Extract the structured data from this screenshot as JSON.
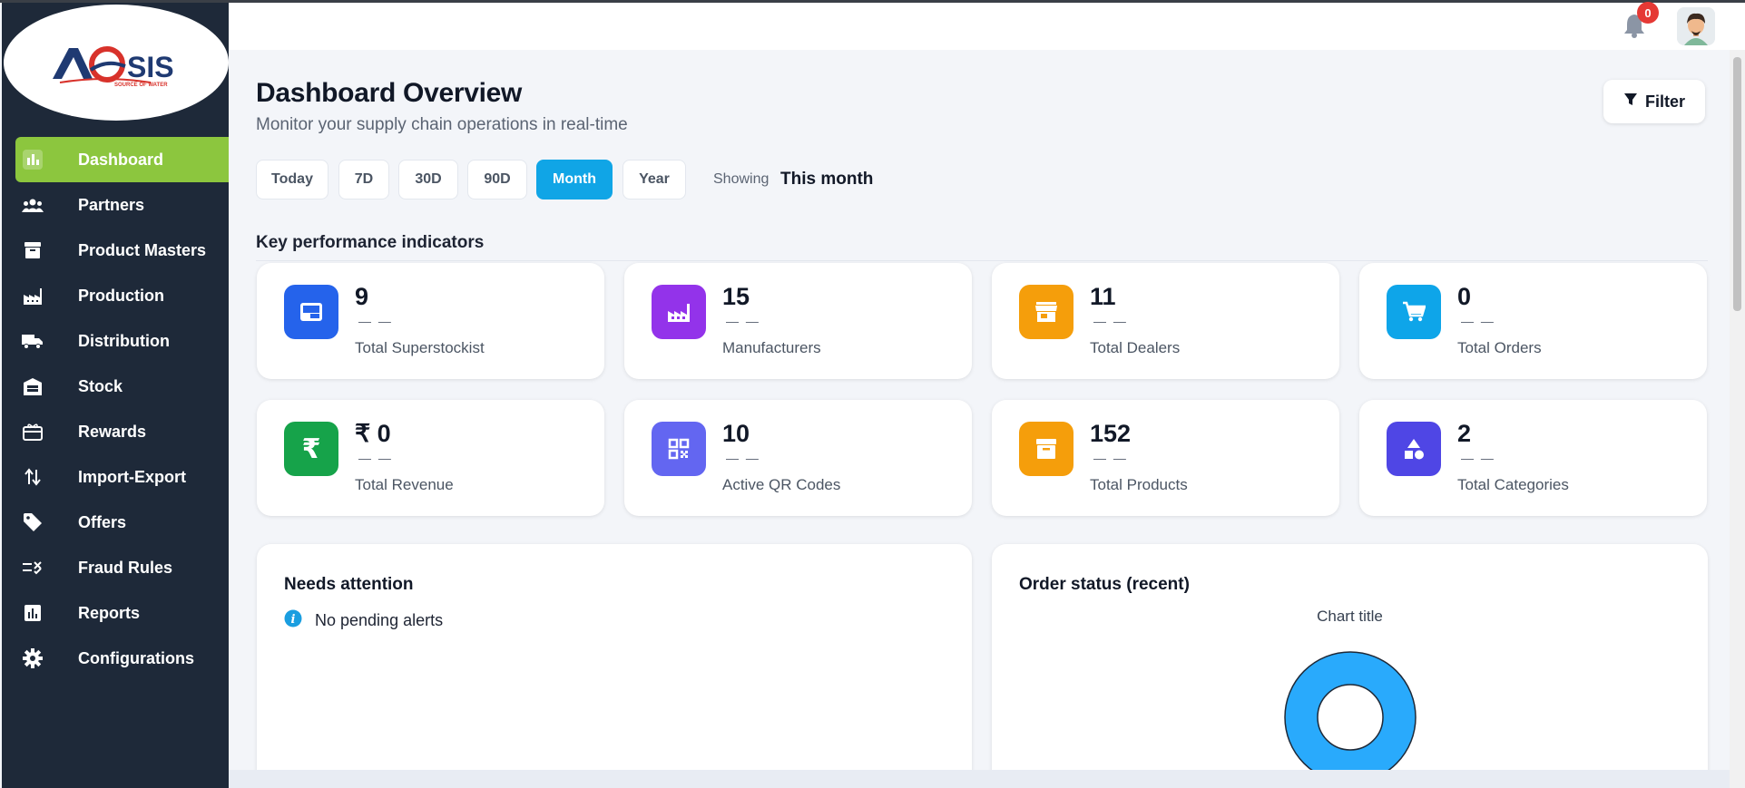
{
  "brand": {
    "logo_text": "AQSIS",
    "tagline": "SOURCE OF WATER"
  },
  "sidebar": {
    "items": [
      {
        "label": "Dashboard",
        "icon": "bar-chart-icon",
        "active": true
      },
      {
        "label": "Partners",
        "icon": "group-icon"
      },
      {
        "label": "Product Masters",
        "icon": "archive-box-icon"
      },
      {
        "label": "Production",
        "icon": "factory-icon"
      },
      {
        "label": "Distribution",
        "icon": "truck-icon"
      },
      {
        "label": "Stock",
        "icon": "warehouse-icon"
      },
      {
        "label": "Rewards",
        "icon": "gift-card-icon"
      },
      {
        "label": "Import-Export",
        "icon": "swap-arrows-icon"
      },
      {
        "label": "Offers",
        "icon": "tag-icon"
      },
      {
        "label": "Fraud Rules",
        "icon": "rule-icon"
      },
      {
        "label": "Reports",
        "icon": "report-icon"
      },
      {
        "label": "Configurations",
        "icon": "gear-icon"
      }
    ]
  },
  "header": {
    "notification_count": "0"
  },
  "main": {
    "title": "Dashboard Overview",
    "subtitle": "Monitor your supply chain operations in real-time",
    "filter_label": "Filter",
    "ranges": [
      "Today",
      "7D",
      "30D",
      "90D",
      "Month",
      "Year"
    ],
    "active_range": "Month",
    "showing_label": "Showing",
    "showing_value": "This month",
    "kpi_section_title": "Key performance indicators",
    "kpis": [
      {
        "value": "9",
        "trend": "— —",
        "label": "Total Superstockist",
        "color": "#2563eb",
        "icon": "id-card-icon"
      },
      {
        "value": "15",
        "trend": "— —",
        "label": "Manufacturers",
        "color": "#9333ea",
        "icon": "factory-icon"
      },
      {
        "value": "11",
        "trend": "— —",
        "label": "Total Dealers",
        "color": "#f59e0b",
        "icon": "store-icon"
      },
      {
        "value": "0",
        "trend": "— —",
        "label": "Total Orders",
        "color": "#0ea5e9",
        "icon": "cart-icon"
      },
      {
        "value": "₹ 0",
        "trend": "— —",
        "label": "Total Revenue",
        "color": "#16a34a",
        "icon": "rupee-icon"
      },
      {
        "value": "10",
        "trend": "— —",
        "label": "Active QR Codes",
        "color": "#6366f1",
        "icon": "qr-code-icon"
      },
      {
        "value": "152",
        "trend": "— —",
        "label": "Total Products",
        "color": "#f59e0b",
        "icon": "archive-box-icon"
      },
      {
        "value": "2",
        "trend": "— —",
        "label": "Total Categories",
        "color": "#4f46e5",
        "icon": "shapes-icon"
      }
    ],
    "attention": {
      "title": "Needs attention",
      "message": "No pending alerts"
    },
    "order_status": {
      "title": "Order status (recent)",
      "chart_title": "Chart title"
    }
  },
  "chart_data": {
    "type": "pie",
    "title": "Chart title",
    "slices": [
      {
        "value": 1,
        "color": "#29aafc"
      }
    ]
  }
}
